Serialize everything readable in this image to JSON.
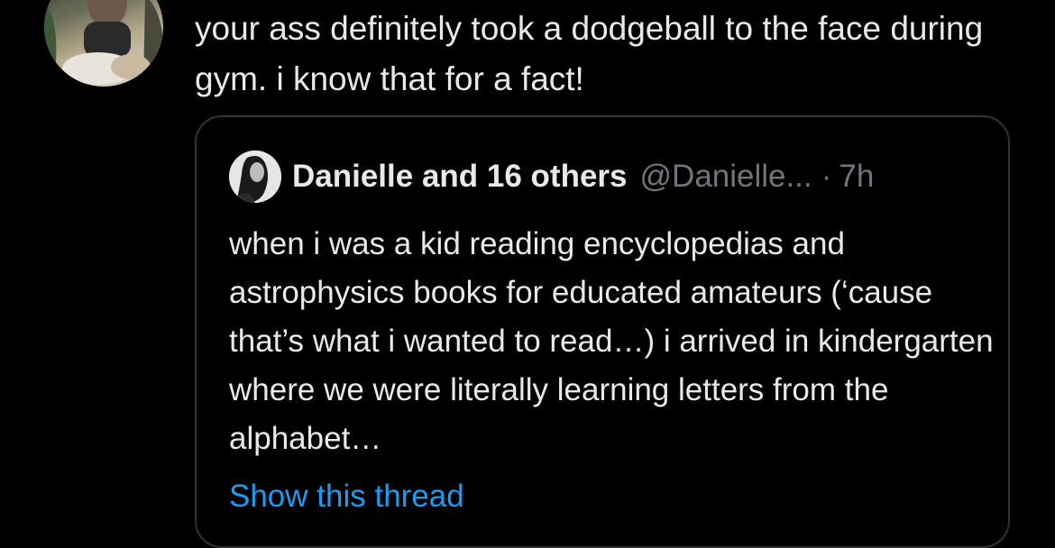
{
  "tweet": {
    "text": "your ass definitely took a dodgeball to the face during gym. i know that for a fact!"
  },
  "quote": {
    "author_name": "Danielle and 16 others",
    "handle": "@Danielle...",
    "separator": "·",
    "time": "7h",
    "text": "when i was a kid reading encyclopedias and astrophysics books for educated amateurs (‘cause that’s what i wanted to read…) i arrived in kindergarten where we were literally learning letters from the alphabet…",
    "show_thread_label": "Show this thread"
  },
  "colors": {
    "background": "#000000",
    "primary_text": "#e7e9ea",
    "secondary_text": "#71767b",
    "link": "#1d9bf0",
    "card_border": "#2f3336"
  }
}
